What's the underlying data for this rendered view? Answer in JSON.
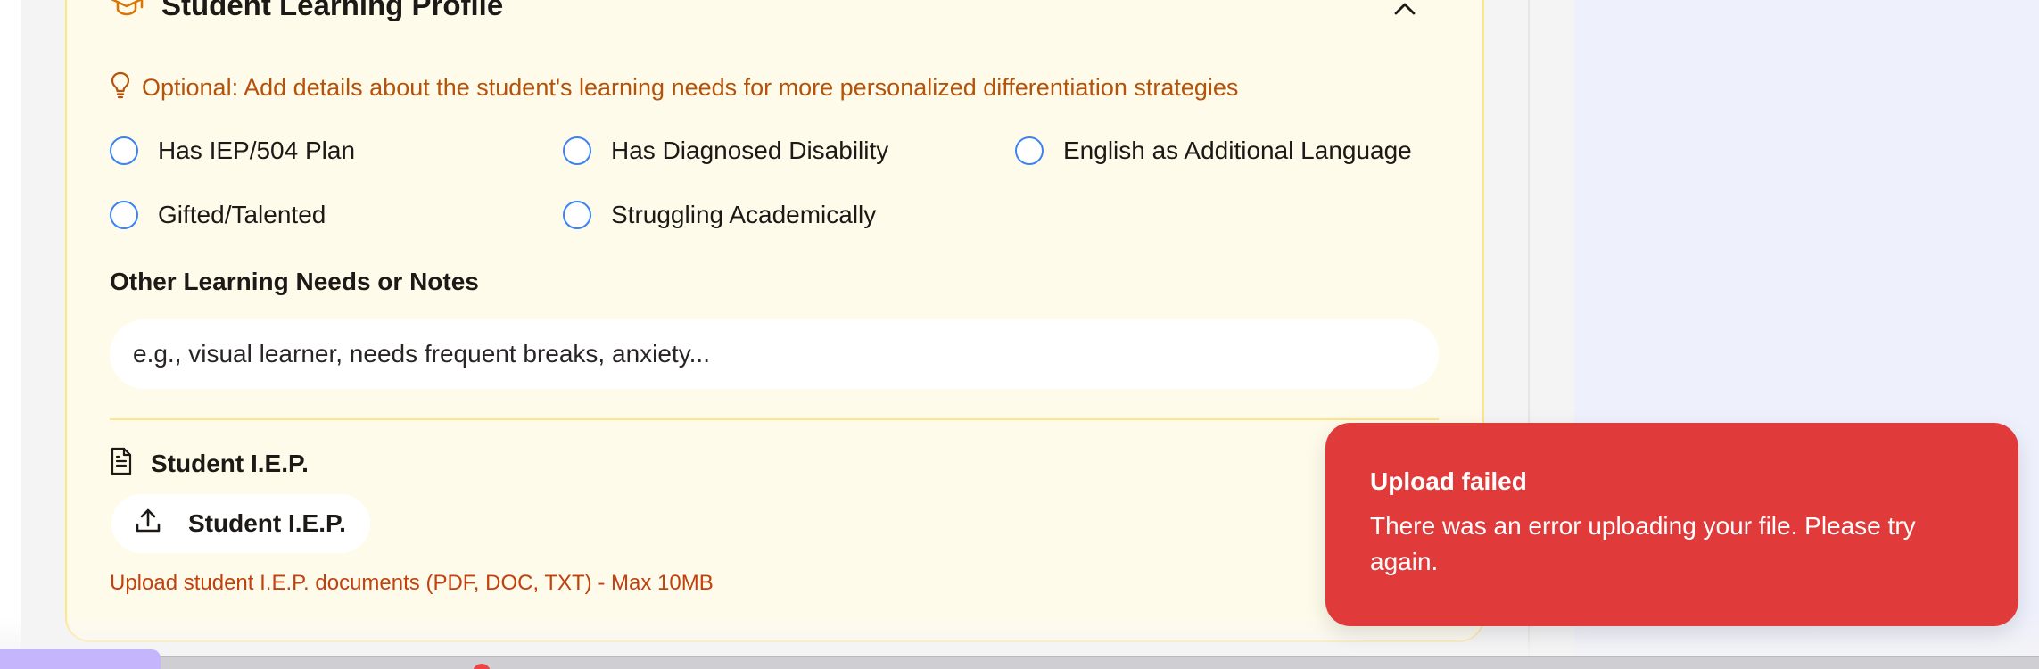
{
  "card": {
    "title": "Student Learning Profile",
    "hint": "Optional: Add details about the student's learning needs for more personalized differentiation strategies",
    "options": [
      "Has IEP/504 Plan",
      "Has Diagnosed Disability",
      "English as Additional Language",
      "Gifted/Talented",
      "Struggling Academically"
    ],
    "notes_label": "Other Learning Needs or Notes",
    "notes_placeholder": "e.g., visual learner, needs frequent breaks, anxiety...",
    "notes_value": "",
    "iep_heading": "Student I.E.P.",
    "upload_label": "Student I.E.P.",
    "upload_help": "Upload student I.E.P. documents (PDF, DOC, TXT) - Max 10MB"
  },
  "toast": {
    "title": "Upload failed",
    "message": "There was an error uploading your file. Please try again."
  },
  "icons": {
    "header": "graduation-cap-icon",
    "collapse": "chevron-up-icon",
    "hint": "lightbulb-icon",
    "iep": "document-icon",
    "upload": "upload-icon"
  },
  "colors": {
    "card_bg": "#fffbeb",
    "card_border": "#fde68a",
    "accent_orange": "#b45309",
    "checkbox_blue": "#3b82f6",
    "toast_red": "#e03a3a"
  }
}
